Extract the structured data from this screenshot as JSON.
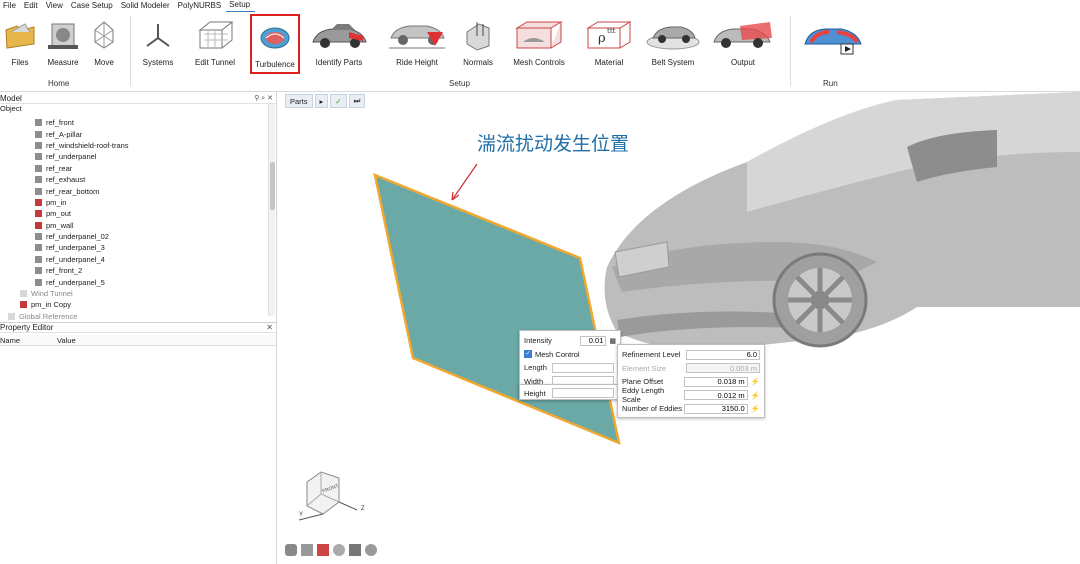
{
  "menu": [
    "File",
    "Edit",
    "View",
    "Case Setup",
    "Solid Modeler",
    "PolyNURBS",
    "Setup"
  ],
  "ribbon": {
    "home_label": "Home",
    "setup_label": "Setup",
    "run_label": "Run",
    "buttons": {
      "files": "Files",
      "measure": "Measure",
      "move": "Move",
      "systems": "Systems",
      "edit_tunnel": "Edit Tunnel",
      "turbulence": "Turbulence",
      "identify_parts": "Identify Parts",
      "ride_height": "Ride Height",
      "normals": "Normals",
      "mesh_controls": "Mesh Controls",
      "material": "Material",
      "belt_system": "Belt System",
      "output": "Output"
    },
    "selected_color": "#e02020"
  },
  "model_panel": {
    "title": "Model",
    "column": "Object",
    "items": [
      "ref_front",
      "ref_A-pillar",
      "ref_windshield-roof-trans",
      "ref_underpanel",
      "ref_rear",
      "ref_exhaust",
      "ref_rear_bottom",
      "pm_in",
      "pm_out",
      "pm_wall",
      "ref_underpanel_02",
      "ref_underpanel_3",
      "ref_underpanel_4",
      "ref_front_2",
      "ref_underpanel_5"
    ],
    "wind_tunnel": "Wind Tunnel",
    "pm_in_copy": "pm_in Copy",
    "global_ref": "Global Reference"
  },
  "property_editor": {
    "title": "Property Editor",
    "col_name": "Name",
    "col_value": "Value"
  },
  "viewport": {
    "parts_tab": "Parts",
    "annotation": "湍流扰动发生位置",
    "plane_color": "#6aa9a6",
    "plane_edge_color": "#f0a830",
    "annotation_color": "#1f6fa7"
  },
  "turbulence_popup": {
    "intensity_label": "Intensity",
    "intensity_value": "0.01",
    "mesh_control_label": "Mesh Control",
    "length_label": "Length",
    "width_label": "Width",
    "height_label": "Height"
  },
  "mesh_popup": {
    "refinement_level_label": "Refinement Level",
    "refinement_level_value": "6.0",
    "element_size_label": "Element Size",
    "element_size_value": "0.003 m",
    "plane_offset_label": "Plane Offset",
    "plane_offset_value": "0.018 m",
    "eddy_length_label": "Eddy Length Scale",
    "eddy_length_value": "0.012 m",
    "num_eddies_label": "Number of Eddies",
    "num_eddies_value": "3150.0"
  },
  "viewcube_label": "FRONT",
  "axis": {
    "z": "Z",
    "y": "Y"
  }
}
